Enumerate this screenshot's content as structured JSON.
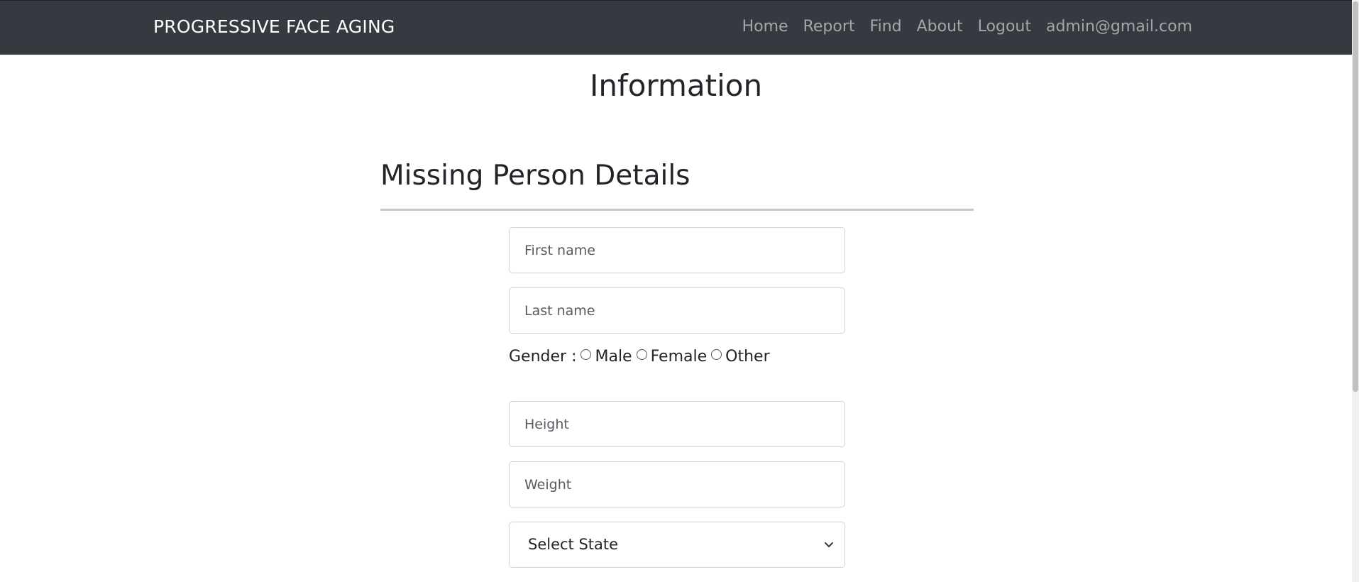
{
  "navbar": {
    "brand": "PROGRESSIVE FACE AGING",
    "links": [
      "Home",
      "Report",
      "Find",
      "About",
      "Logout",
      "admin@gmail.com"
    ]
  },
  "page": {
    "title": "Information",
    "section_title": "Missing Person Details"
  },
  "form": {
    "first_name_placeholder": "First name",
    "last_name_placeholder": "Last name",
    "gender_label": "Gender :",
    "gender_options": [
      "Male",
      "Female",
      "Other"
    ],
    "height_placeholder": "Height",
    "weight_placeholder": "Weight",
    "state_select_value": "Select State"
  },
  "icons": {
    "select_arrow": "chevron-down-icon",
    "radio": "radio-button-icon"
  },
  "colors": {
    "navbar_bg": "#343a40",
    "brand": "#ffffff",
    "nav_link": "#9a9da0",
    "divider": "#c8c8c8",
    "input_border": "#ced4da"
  }
}
